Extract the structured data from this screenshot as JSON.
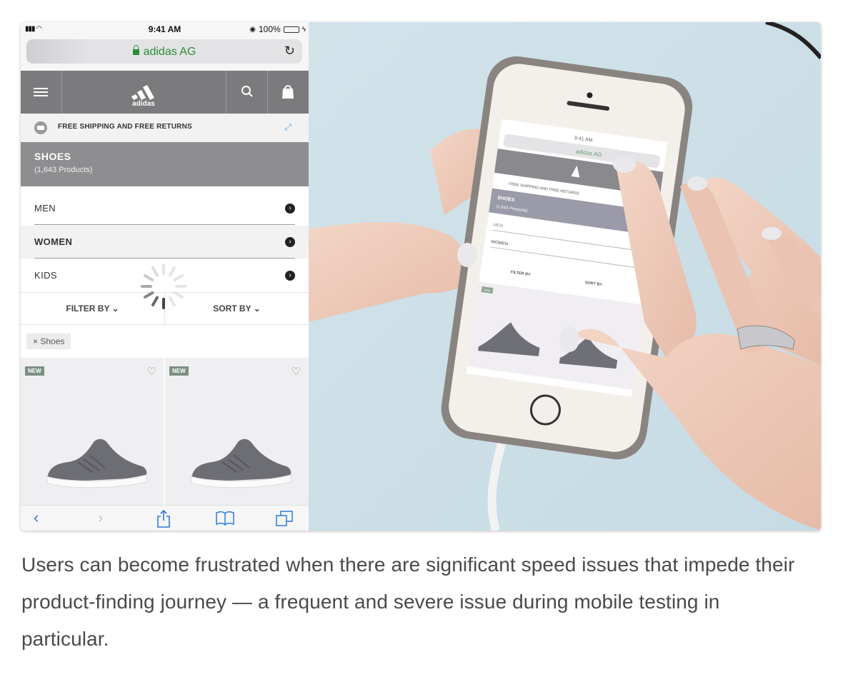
{
  "status_bar": {
    "time": "9:41 AM",
    "battery": "100%",
    "battery_level": 1.0
  },
  "url_bar": {
    "site": "adidas AG"
  },
  "nav": {
    "logo_text": "adidas"
  },
  "banner": {
    "text": "FREE SHIPPING AND FREE RETURNS"
  },
  "category_header": {
    "title": "SHOES",
    "count": "(1,643 Products)"
  },
  "categories": [
    {
      "label": "MEN"
    },
    {
      "label": "WOMEN"
    },
    {
      "label": "KIDS"
    }
  ],
  "filter": {
    "filter_label": "FILTER BY",
    "sort_label": "SORT BY"
  },
  "active_filter_chip": {
    "label": "Shoes"
  },
  "products": [
    {
      "badge": "NEW"
    },
    {
      "badge": "NEW"
    }
  ],
  "photo_phone": {
    "time": "9:41 AM",
    "site": "adidas AG",
    "banner": "FREE SHIPPING AND FREE RETURNS",
    "title": "SHOES",
    "count": "(1,643 Products)",
    "men": "MEN",
    "women": "WOMEN",
    "filter": "FILTER BY",
    "sort": "SORT BY",
    "badge": "NEW"
  },
  "caption": "Users can become frustrated when there are significant speed issues that impede their product-finding journey — a frequent and severe issue during mobile testing in particular.",
  "colors": {
    "nav_gray": "#7b7b7e",
    "header_gray": "#8e8e91",
    "secure_green": "#2a8c3a",
    "ios_blue": "#2a7ad8",
    "caption_text": "#4a4a4a"
  }
}
